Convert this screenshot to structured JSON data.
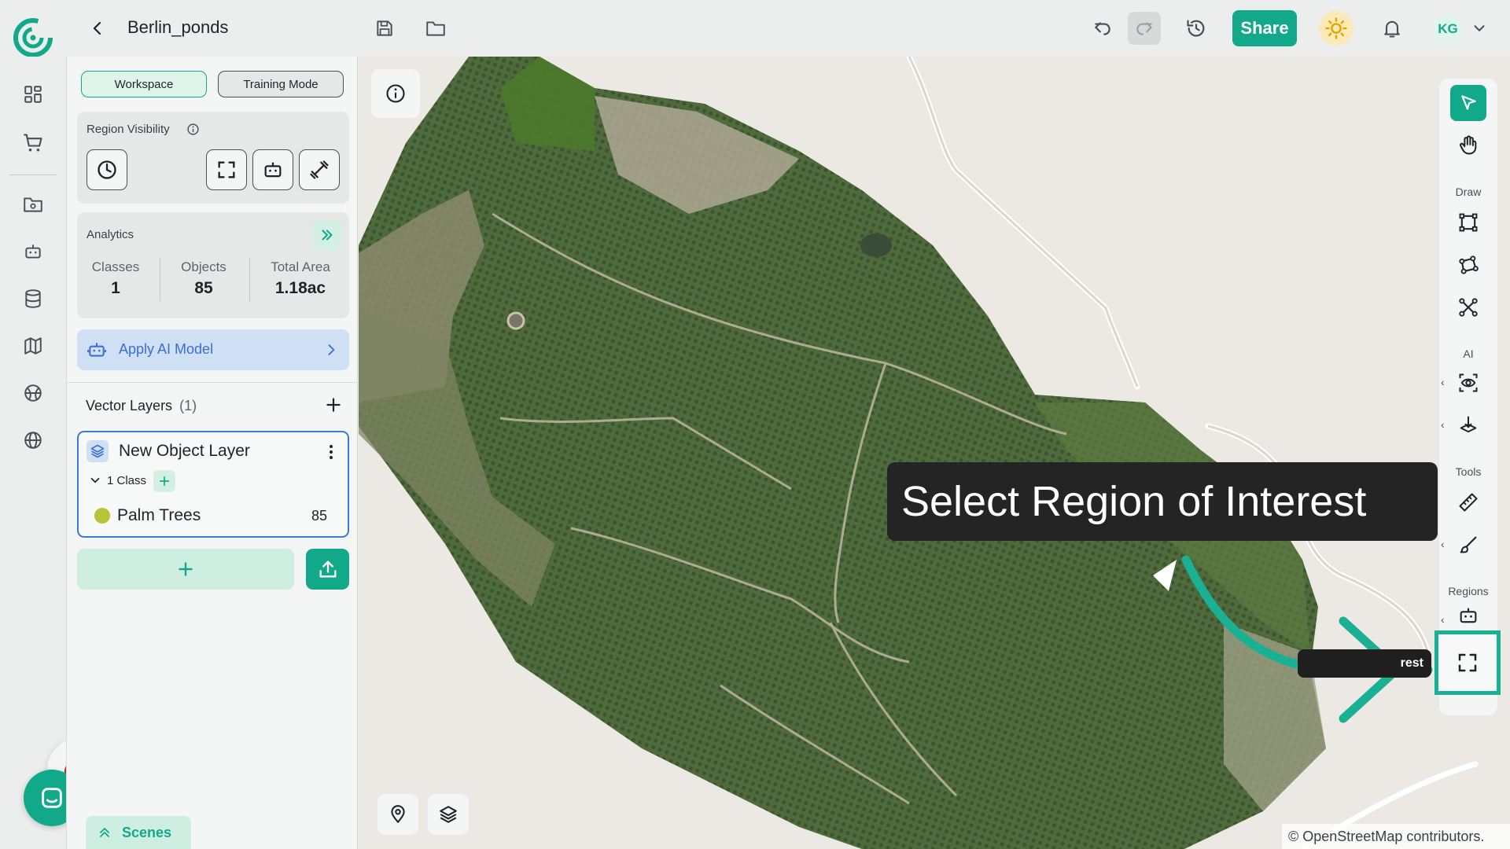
{
  "header": {
    "title": "Berlin_ponds",
    "share_label": "Share",
    "avatar_initials": "KG"
  },
  "panel": {
    "tabs": [
      {
        "label": "Workspace",
        "active": true
      },
      {
        "label": "Training Mode",
        "active": false
      }
    ],
    "region_visibility": {
      "title": "Region Visibility"
    },
    "analytics": {
      "title": "Analytics",
      "stats": [
        {
          "label": "Classes",
          "value": "1"
        },
        {
          "label": "Objects",
          "value": "85"
        },
        {
          "label": "Total Area",
          "value": "1.18ac"
        }
      ]
    },
    "apply_ai": {
      "label": "Apply AI Model"
    },
    "vector_layers": {
      "title": "Vector Layers",
      "count": "(1)",
      "layer": {
        "name": "New Object Layer",
        "class_count": "1 Class",
        "classes": [
          {
            "name": "Palm Trees",
            "count": "85",
            "color": "#b7c43a"
          }
        ]
      }
    },
    "scenes_label": "Scenes"
  },
  "toolbar": {
    "sections": {
      "draw": "Draw",
      "ai": "AI",
      "tools": "Tools",
      "regions": "Regions"
    },
    "hover_tooltip_fragment": "rest"
  },
  "tooltip": {
    "text": "Select Region of Interest"
  },
  "map": {
    "attribution": "© OpenStreetMap contributors."
  },
  "colors": {
    "accent": "#12a88a",
    "highlight": "#19b093",
    "apply_ai_bg": "#cfe0f5",
    "apply_ai_text": "#3b6fd1"
  }
}
